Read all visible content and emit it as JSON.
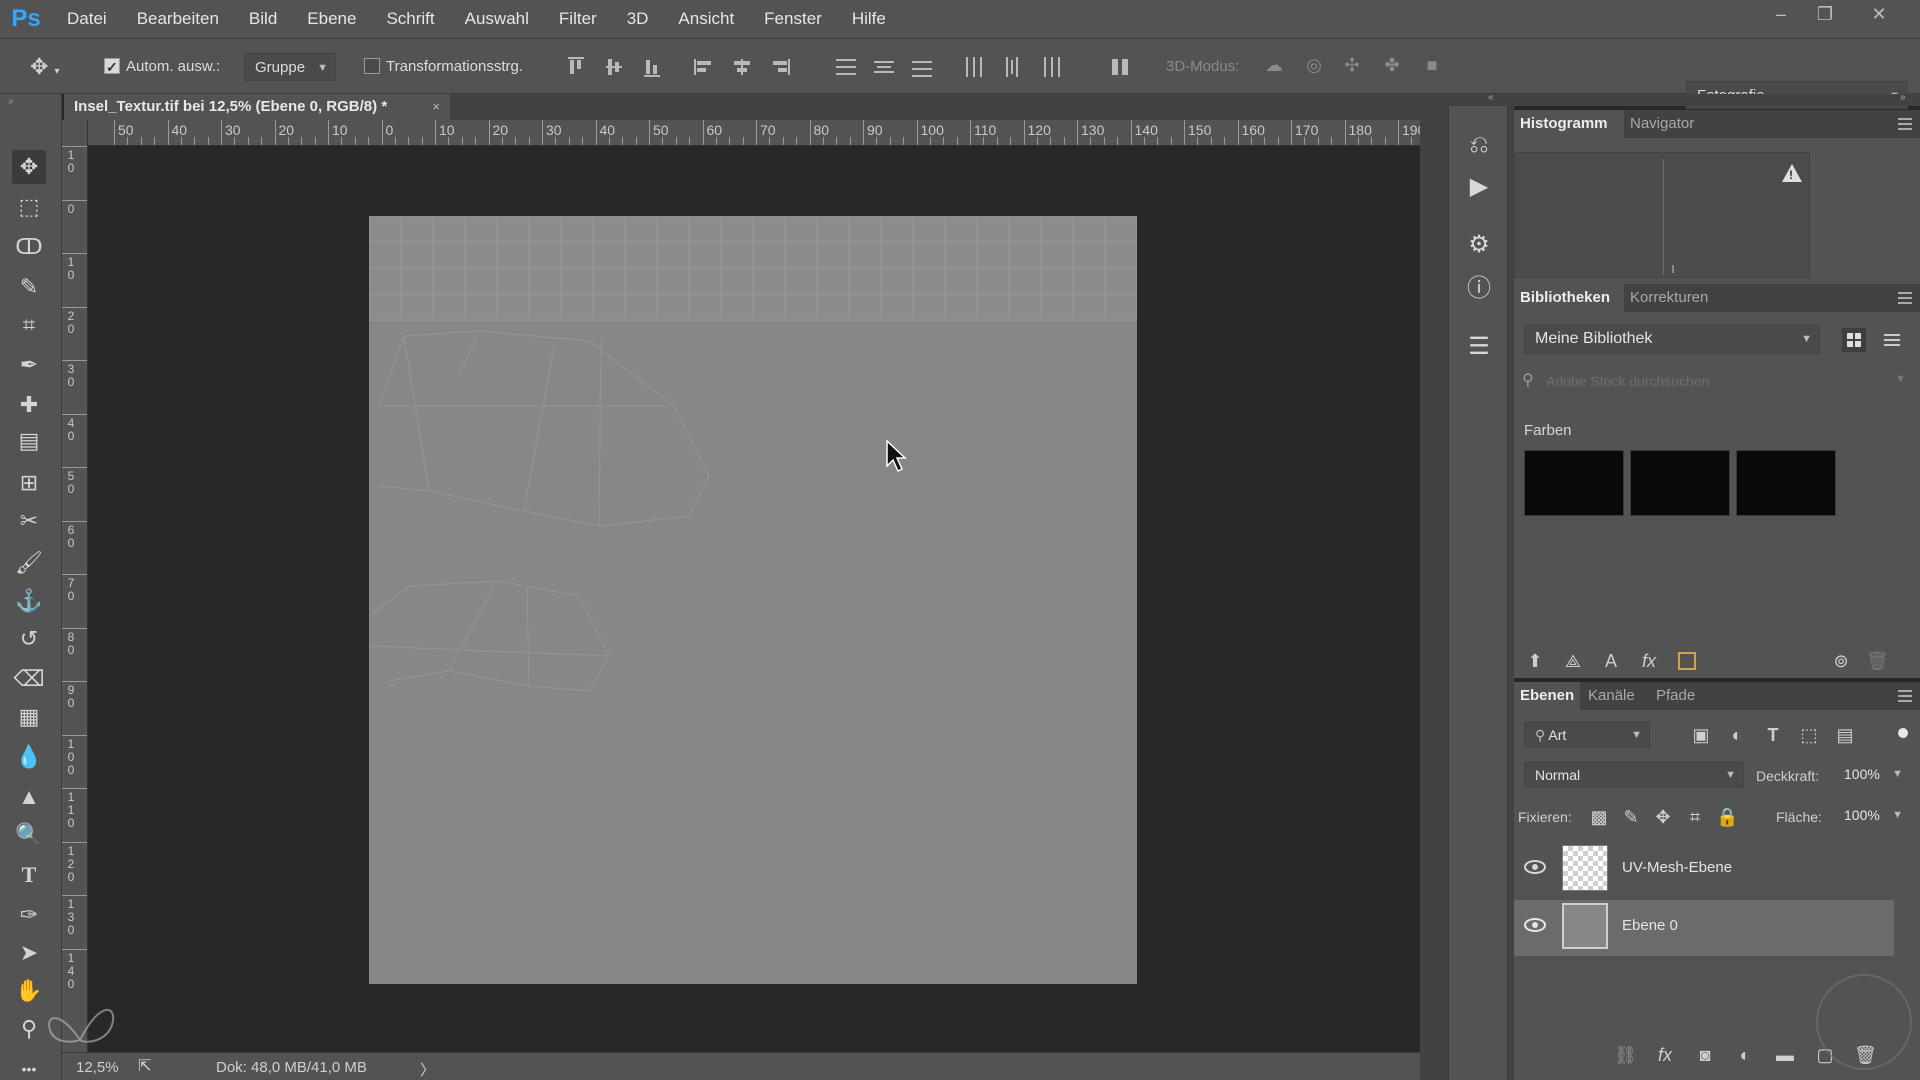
{
  "app": {
    "logo": "Ps"
  },
  "menu": [
    "Datei",
    "Bearbeiten",
    "Bild",
    "Ebene",
    "Schrift",
    "Auswahl",
    "Filter",
    "3D",
    "Ansicht",
    "Fenster",
    "Hilfe"
  ],
  "window_controls": {
    "minimize": "–",
    "restore": "❐",
    "close": "✕"
  },
  "options": {
    "auto_select_label": "Autom. ausw.:",
    "auto_select_checked": true,
    "auto_select_target": "Gruppe",
    "transform_label": "Transformationsstrg.",
    "mode_3d_label": "3D-Modus:",
    "workspace": "Fotografie"
  },
  "document": {
    "tab_title": "Insel_Textur.tif bei 12,5% (Ebene 0, RGB/8) *",
    "close": "×",
    "zoom": "12,5%",
    "doc_info": "Dok: 48,0 MB/41,0 MB",
    "status_arrow": "〉"
  },
  "ruler": {
    "h_labels": [
      "50",
      "40",
      "30",
      "20",
      "10",
      "0",
      "10",
      "20",
      "30",
      "40",
      "50",
      "60",
      "70",
      "80",
      "90",
      "100",
      "110",
      "120",
      "130",
      "140",
      "150",
      "160",
      "170",
      "180",
      "190"
    ],
    "v_labels": [
      "1 0",
      "0",
      "1 0",
      "2 0",
      "3 0",
      "4 0",
      "5 0",
      "6 0",
      "7 0",
      "8 0",
      "9 0",
      "1 0 0",
      "1 1 0",
      "1 2 0",
      "1 3 0",
      "1 4 0"
    ]
  },
  "tools": [
    {
      "name": "move-tool",
      "glyph": "✥"
    },
    {
      "name": "marquee-tool",
      "glyph": "⬚"
    },
    {
      "name": "lasso-tool",
      "glyph": "ↀ"
    },
    {
      "name": "quick-select-tool",
      "glyph": "✎"
    },
    {
      "name": "crop-tool",
      "glyph": "⌗"
    },
    {
      "name": "eyedropper-tool",
      "glyph": "✒"
    },
    {
      "name": "healing-brush-tool",
      "glyph": "✚"
    },
    {
      "name": "patch-tool",
      "glyph": "▤"
    },
    {
      "name": "content-aware-move-tool",
      "glyph": "⊞"
    },
    {
      "name": "puppet-warp-tool",
      "glyph": "✂"
    },
    {
      "name": "brush-tool",
      "glyph": "🖌"
    },
    {
      "name": "clone-stamp-tool",
      "glyph": "⚓"
    },
    {
      "name": "history-brush-tool",
      "glyph": "↺"
    },
    {
      "name": "eraser-tool",
      "glyph": "⌫"
    },
    {
      "name": "gradient-tool",
      "glyph": "▦"
    },
    {
      "name": "blur-tool",
      "glyph": "💧"
    },
    {
      "name": "sharpen-tool",
      "glyph": "▲"
    },
    {
      "name": "dodge-tool",
      "glyph": "🔍"
    },
    {
      "name": "type-tool",
      "glyph": "T"
    },
    {
      "name": "pen-tool",
      "glyph": "✑"
    },
    {
      "name": "path-select-tool",
      "glyph": "➤"
    },
    {
      "name": "hand-tool",
      "glyph": "✋"
    },
    {
      "name": "zoom-tool",
      "glyph": "⚲"
    },
    {
      "name": "more-tools",
      "glyph": "•••"
    }
  ],
  "histogram_panel": {
    "tabs": [
      "Histogramm",
      "Navigator"
    ],
    "warning": "!"
  },
  "libraries_panel": {
    "tabs": [
      "Bibliotheken",
      "Korrekturen"
    ],
    "library": "Meine Bibliothek",
    "search_placeholder": "Adobe Stock durchsuchen",
    "colors_label": "Farben",
    "swatches": [
      "#0a0a0a",
      "#0a0a0a",
      "#0a0a0a"
    ]
  },
  "layers_panel": {
    "tabs": [
      "Ebenen",
      "Kanäle",
      "Pfade"
    ],
    "filter_kind": "Art",
    "blend_mode": "Normal",
    "opacity_label": "Deckkraft:",
    "opacity": "100%",
    "lock_label": "Fixieren:",
    "fill_label": "Fläche:",
    "fill": "100%",
    "layers": [
      {
        "name": "UV-Mesh-Ebene",
        "visible": true,
        "selected": false
      },
      {
        "name": "Ebene 0",
        "visible": true,
        "selected": true
      }
    ]
  }
}
